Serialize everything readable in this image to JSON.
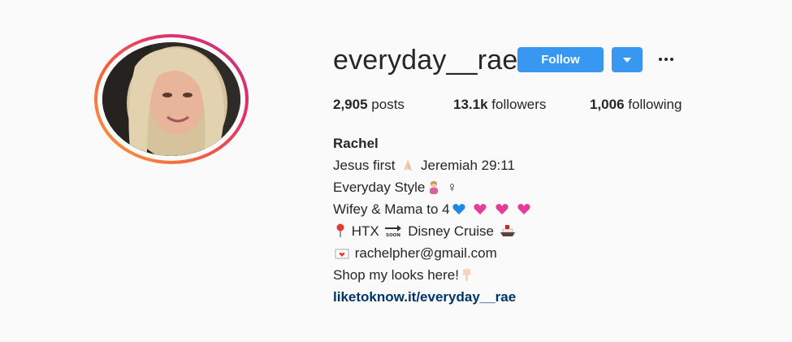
{
  "profile": {
    "username": "everyday__rae",
    "follow_label": "Follow",
    "stats": {
      "posts_count": "2,905",
      "posts_label": "posts",
      "followers_count": "13.1k",
      "followers_label": "followers",
      "following_count": "1,006",
      "following_label": "following"
    },
    "bio": {
      "name": "Rachel",
      "line1_a": "Jesus first",
      "line1_b": "Jeremiah 29:11",
      "line2_a": "Everyday Style",
      "line2_b": "♀",
      "line3_a": "Wifey & Mama to 4",
      "line4_a": "HTX",
      "line4_soon": "SOON",
      "line4_b": "Disney Cruise",
      "line5_email": "rachelpher@gmail.com",
      "line6": "Shop my looks here!",
      "link": "liketoknow.it/everyday__rae"
    }
  },
  "colors": {
    "follow_blue": "#3897f0",
    "link_blue": "#003569",
    "text": "#262626",
    "background": "#fafafa"
  },
  "icons": [
    "chevron-down-icon",
    "more-options-icon",
    "praying-hands-icon",
    "woman-tipping-hand-icon",
    "blue-heart-icon",
    "pink-heart-icon",
    "pin-icon",
    "soon-arrow-icon",
    "ship-icon",
    "love-letter-icon",
    "pointing-down-icon"
  ]
}
